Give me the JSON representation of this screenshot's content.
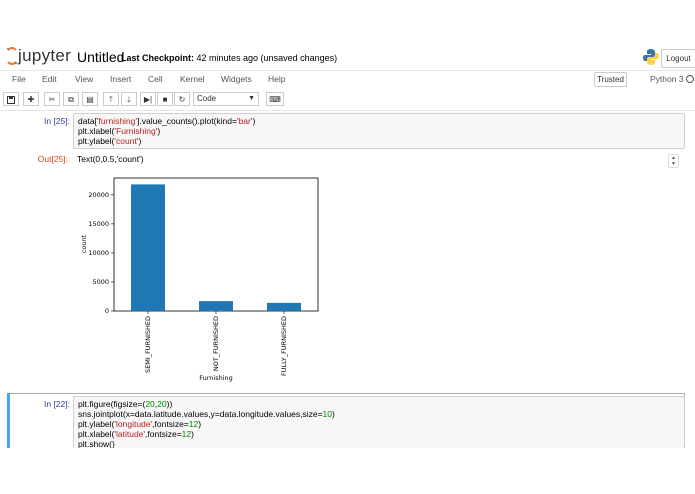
{
  "header": {
    "logo_text": "jupyter",
    "notebook_title": "Untitled",
    "checkpoint_label": "Last Checkpoint:",
    "checkpoint_text": " 42 minutes ago (unsaved changes)",
    "logout_label": "Logout"
  },
  "menu": {
    "items": [
      "File",
      "Edit",
      "View",
      "Insert",
      "Cell",
      "Kernel",
      "Widgets",
      "Help"
    ],
    "trusted_label": "Trusted",
    "kernel_name": "Python 3"
  },
  "toolbar": {
    "cell_type": "Code",
    "icons": [
      "save-icon",
      "plus-icon",
      "cut-icon",
      "copy-icon",
      "paste-icon",
      "arrow-up-icon",
      "arrow-down-icon",
      "step-forward-icon",
      "stop-icon",
      "restart-icon",
      "keyboard-icon"
    ]
  },
  "cells": [
    {
      "prompt": "In [25]:",
      "lines": [
        [
          "data[",
          "'furnishing'",
          "].value_counts().plot(kind=",
          "'bar'",
          ")"
        ],
        [
          "plt.xlabel(",
          "'Furnishing'",
          ")"
        ],
        [
          "plt.ylabel(",
          "'count'",
          ")"
        ]
      ],
      "out_prompt": "Out[25]:",
      "out_text": "Text(0,0.5,'count')"
    },
    {
      "prompt": "In [22]:",
      "lines": [
        "plt.figure(figsize=(20,20))",
        "sns.jointplot(x=data.latitude.values,y=data.longitude.values,size=10)",
        "plt.ylabel('longitude',fontsize=12)",
        "plt.xlabel('latitude',fontsize=12)",
        "plt.show()"
      ]
    }
  ],
  "chart_data": {
    "type": "bar",
    "categories": [
      "SEMI_FURNISHED",
      "NOT_FURNISHED",
      "FULLY_FURNISHED"
    ],
    "values": [
      21800,
      1700,
      1400
    ],
    "xlabel": "Furnishing",
    "ylabel": "count",
    "yticks": [
      0,
      5000,
      10000,
      15000,
      20000
    ],
    "ylim": [
      0,
      22900
    ],
    "bar_color": "#1f77b4",
    "grid": false
  },
  "colors": {
    "in_prompt": "#303f9f",
    "out_prompt": "#d84315",
    "selected_cell": "#42a5f5"
  }
}
